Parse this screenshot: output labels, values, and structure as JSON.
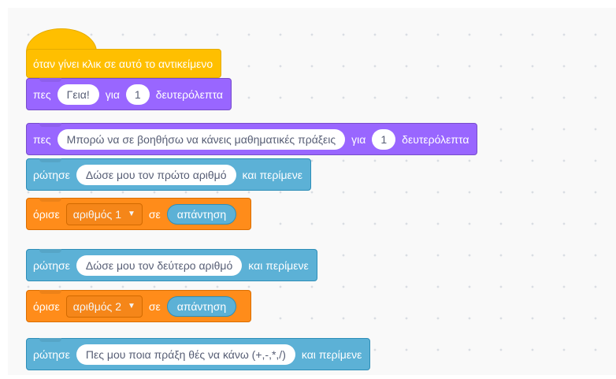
{
  "blocks": {
    "hat": {
      "text": "όταν γίνει κλικ σε αυτό το αντικείμενο"
    },
    "say1": {
      "verb": "πες",
      "message": "Γεια!",
      "for": "για",
      "secs": "1",
      "unit": "δευτερόλεπτα"
    },
    "say2": {
      "verb": "πες",
      "message": "Μπορώ να σε βοηθήσω να κάνεις μαθηματικές πράξεις",
      "for": "για",
      "secs": "1",
      "unit": "δευτερόλεπτα"
    },
    "ask1": {
      "verb": "ρώτησε",
      "question": "Δώσε μου τον πρώτο αριθμό",
      "wait": "και περίμενε"
    },
    "set1": {
      "verb": "όρισε",
      "variable": "αριθμός 1",
      "to": "σε",
      "value": "απάντηση"
    },
    "ask2": {
      "verb": "ρώτησε",
      "question": "Δώσε μου τον δεύτερο αριθμό",
      "wait": "και περίμενε"
    },
    "set2": {
      "verb": "όρισε",
      "variable": "αριθμός 2",
      "to": "σε",
      "value": "απάντηση"
    },
    "ask3": {
      "verb": "ρώτησε",
      "question": "Πες μου ποια πράξη θές να κάνω (+,-,*,/)",
      "wait": "και περίμενε"
    }
  },
  "colors": {
    "events": "#ffbf00",
    "looks": "#9966ff",
    "sensing": "#5cb1d6",
    "variables": "#ff8c1a"
  }
}
